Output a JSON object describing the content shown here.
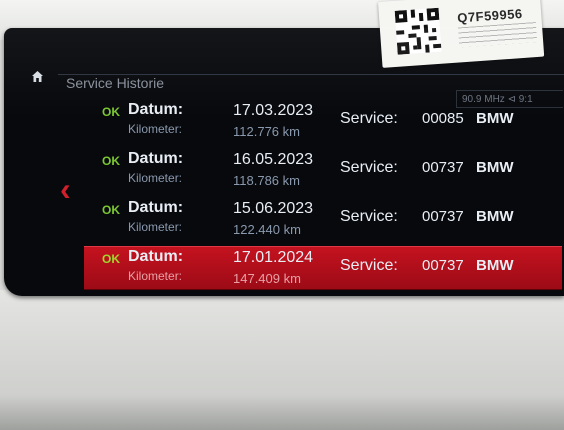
{
  "sticker": {
    "code": "Q7F59956"
  },
  "header": {
    "title": "Service Historie",
    "status": "90.9 MHz ⊲  9:1"
  },
  "labels": {
    "datum": "Datum:",
    "kilometer": "Kilometer:",
    "service": "Service:"
  },
  "entries": [
    {
      "status": "OK",
      "date": "17.03.2023",
      "km": "112.776 km",
      "code": "00085",
      "brand": "BMW"
    },
    {
      "status": "OK",
      "date": "16.05.2023",
      "km": "118.786 km",
      "code": "00737",
      "brand": "BMW"
    },
    {
      "status": "OK",
      "date": "15.06.2023",
      "km": "122.440 km",
      "code": "00737",
      "brand": "BMW"
    },
    {
      "status": "OK",
      "date": "17.01.2024",
      "km": "147.409 km",
      "code": "00737",
      "brand": "BMW",
      "selected": true
    }
  ],
  "icons": {
    "home": "home-icon",
    "back": "chevron-left-icon",
    "qr": "qr-code-icon"
  },
  "colors": {
    "ok": "#7cc832",
    "selection": "#c4121f",
    "back_arrow": "#d0202b"
  }
}
